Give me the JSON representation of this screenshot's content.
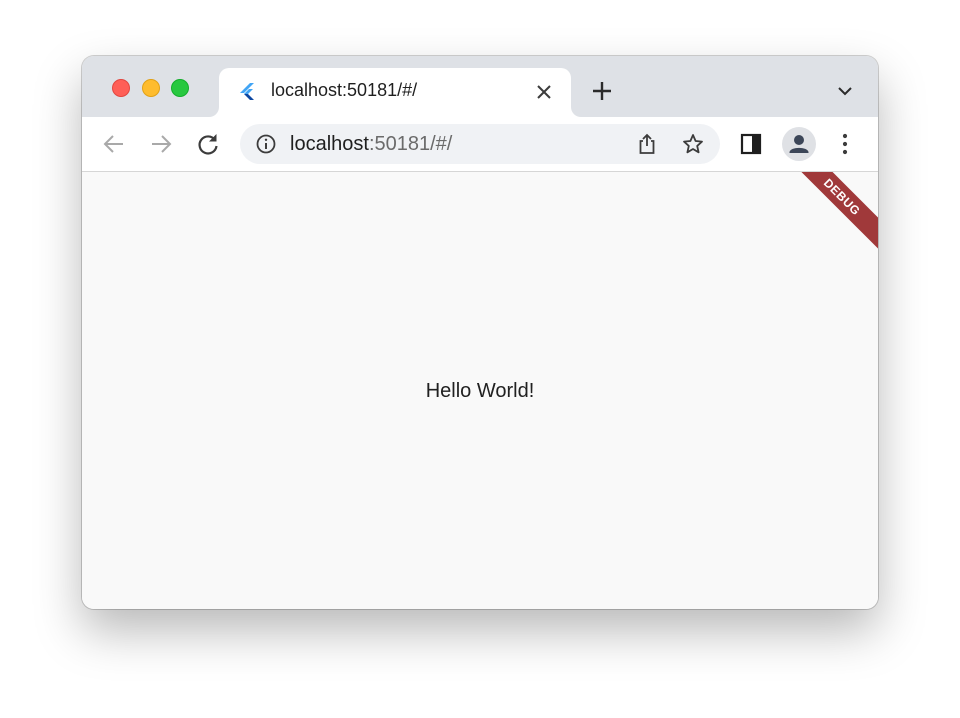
{
  "window": {
    "controls": [
      "close",
      "minimize",
      "maximize"
    ]
  },
  "tab": {
    "title": "localhost:50181/#/",
    "favicon": "flutter-icon"
  },
  "toolbar": {
    "url_host": "localhost",
    "url_rest": ":50181/#/"
  },
  "page": {
    "text": "Hello World!",
    "debug_banner": "DEBUG"
  },
  "colors": {
    "tabstrip": "#dee1e6",
    "omnibox": "#f0f2f5",
    "page_background": "#f9f9f9",
    "debug_banner": "#a0393a"
  }
}
